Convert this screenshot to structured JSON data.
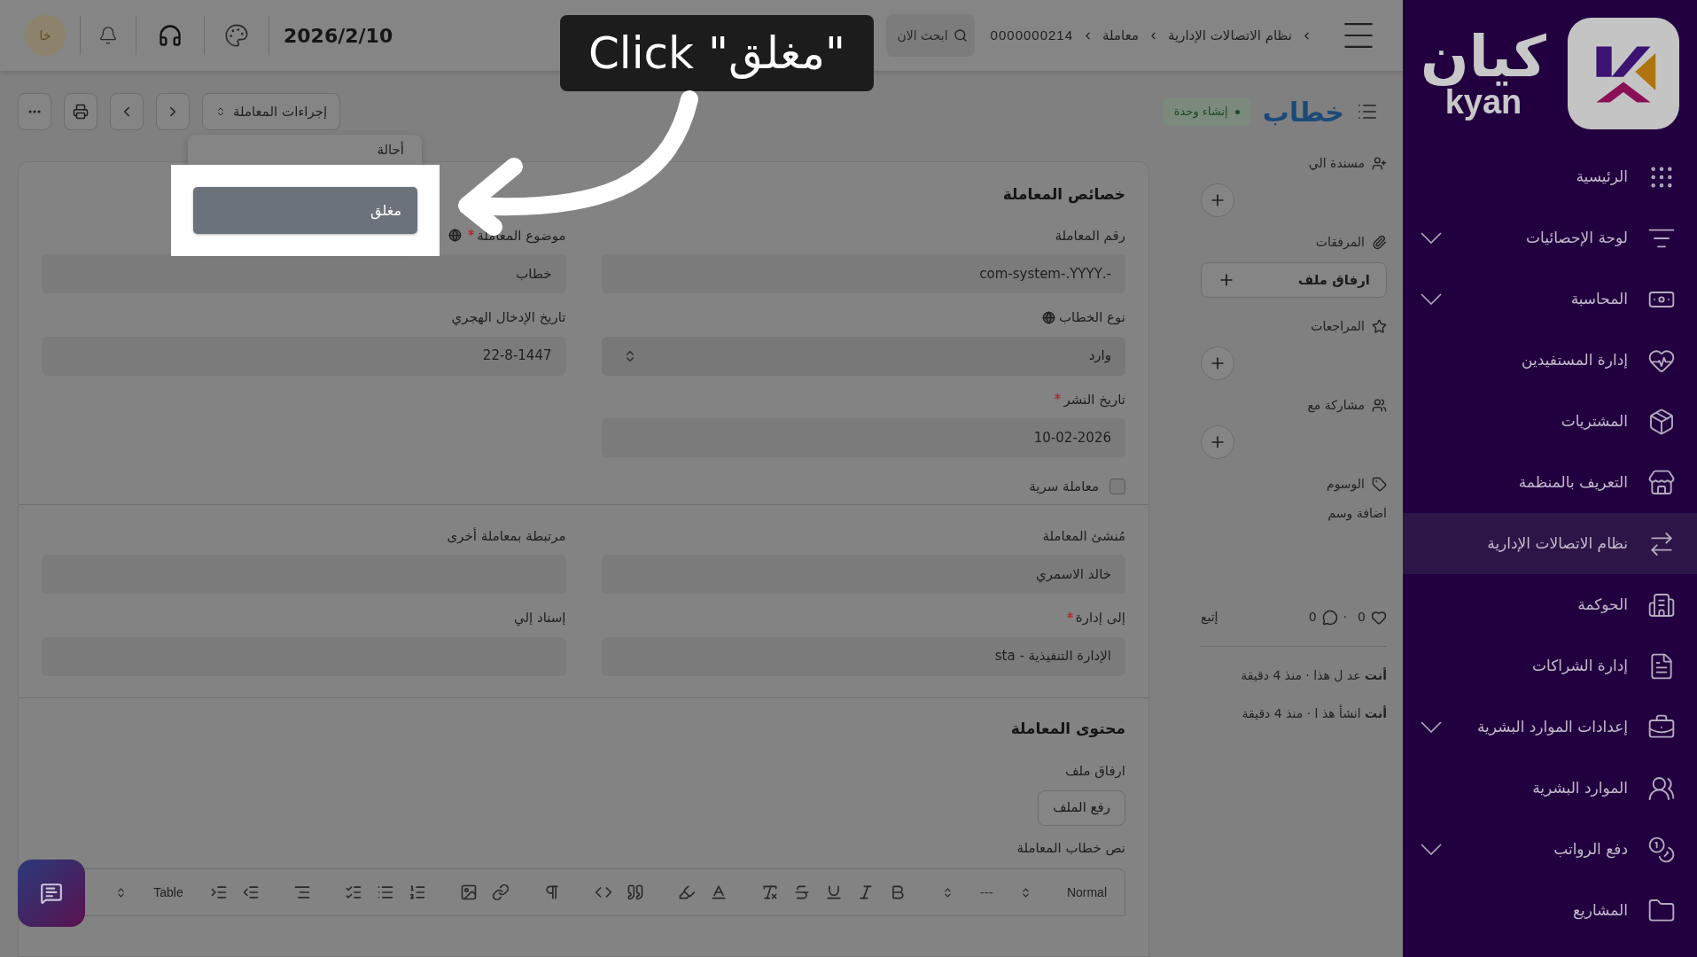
{
  "topbar": {
    "breadcrumb": [
      "نظام الاتصالات الإدارية",
      "معاملة",
      "0000000214"
    ],
    "search": {
      "placeholder": "ابحث الان"
    },
    "date": "2026/2/10",
    "avatar": "خا"
  },
  "header": {
    "title": "خطاب",
    "badge": "إنشاء وحدة",
    "actions_button": "إجراءات المعاملة"
  },
  "actions_menu": {
    "items": [
      {
        "label": "أحالة",
        "selected": false
      },
      {
        "label": "مغلق",
        "selected": true
      }
    ]
  },
  "callout": {
    "text": "Click \"مغلق\""
  },
  "side_panel": {
    "assigned": "مسندة الي",
    "attachments": "المرفقات",
    "attach_button": "ارفاق ملف",
    "reviews": "المراجعات",
    "shared": "مشاركة مع",
    "tags": "الوسوم",
    "add_tag": "اضافة وسم",
    "likes": "0",
    "separator": "·",
    "comments": "0",
    "follow": "إتبع",
    "activity": [
      "**أنت** عد ل هذا · منذ 4 دقيقة",
      "**أنت** انشأ هذ ا · منذ 4 دقيقة"
    ]
  },
  "sections": [
    {
      "title": "خصائص المعاملة",
      "columns": [
        [
          {
            "kind": "input",
            "label": "رقم المعاملة",
            "required": false,
            "globe": false,
            "value": "-.com-system-.YYYY"
          },
          {
            "kind": "select",
            "label": "نوع الخطاب",
            "required": false,
            "globe": true,
            "value": "وارد"
          },
          {
            "kind": "input",
            "label": "تاريخ النشر",
            "required": true,
            "globe": false,
            "value": "10-02-2026"
          },
          {
            "kind": "checkbox",
            "label": "معاملة سرية",
            "checked": false
          }
        ],
        [
          {
            "kind": "input",
            "label": "موضوع المعاملة",
            "required": true,
            "globe": true,
            "value": "خطاب"
          },
          {
            "kind": "input",
            "label": "تاريخ الإدخال الهجري",
            "required": false,
            "globe": false,
            "value": "22-8-1447"
          }
        ]
      ]
    },
    {
      "columns": [
        [
          {
            "kind": "input",
            "label": "مُنشئ المعاملة",
            "required": false,
            "globe": false,
            "value": "خالد الاسمري"
          },
          {
            "kind": "input",
            "label": "إلى إدارة",
            "required": true,
            "globe": false,
            "value": "الإدارة التنفيذية - sta"
          }
        ],
        [
          {
            "kind": "input",
            "label": "مرتبطة بمعاملة أخرى",
            "required": false,
            "globe": false
          },
          {
            "kind": "input",
            "label": "إسناد إلي",
            "required": false,
            "globe": false
          }
        ]
      ]
    }
  ],
  "content": {
    "title": "محتوى المعاملة",
    "attach_label": "ارفاق ملف",
    "upload_button": "رفع الملف",
    "body_label": "نص خطاب المعاملة",
    "toolbar": {
      "style_select": "Normal",
      "divider_item": "---",
      "table_select": "Table"
    }
  },
  "sidebar": {
    "logo_ar": "كيان",
    "logo_en": "kyan",
    "items": [
      {
        "label": "الرئيسية",
        "expandable": false,
        "selected": false
      },
      {
        "label": "لوحة الإحصائيات",
        "expandable": true,
        "selected": false
      },
      {
        "label": "المحاسبة",
        "expandable": true,
        "selected": false
      },
      {
        "label": "إدارة المستفيدين",
        "expandable": false,
        "selected": false
      },
      {
        "label": "المشتريات",
        "expandable": false,
        "selected": false
      },
      {
        "label": "التعريف بالمنظمة",
        "expandable": false,
        "selected": false
      },
      {
        "label": "نظام الاتصالات الإدارية",
        "expandable": false,
        "selected": true
      },
      {
        "label": "الحوكمة",
        "expandable": false,
        "selected": false
      },
      {
        "label": "إدارة الشراكات",
        "expandable": false,
        "selected": false
      },
      {
        "label": "إعدادات الموارد البشرية",
        "expandable": true,
        "selected": false
      },
      {
        "label": "الموارد البشرية",
        "expandable": false,
        "selected": false
      },
      {
        "label": "دفع الرواتب",
        "expandable": true,
        "selected": false
      },
      {
        "label": "المشاريع",
        "expandable": false,
        "selected": false
      }
    ]
  }
}
